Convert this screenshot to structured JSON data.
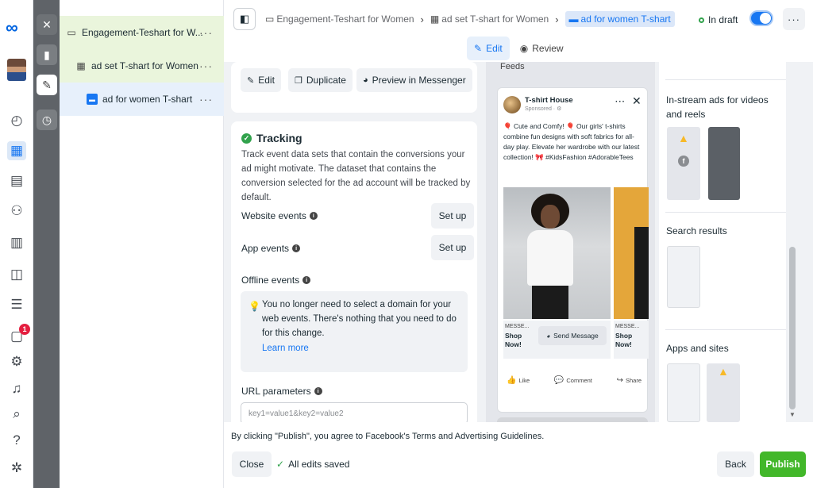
{
  "rail": {
    "logo_icon": "meta-logo-icon",
    "icons": [
      "dashboard-icon",
      "campaigns-grid-icon",
      "pages-icon",
      "audiences-icon",
      "catalog-icon",
      "media-library-icon",
      "menu-icon",
      "notifications-icon",
      "settings-icon",
      "bell-icon",
      "search-icon",
      "help-icon",
      "bug-report-icon"
    ],
    "notification_count": "1"
  },
  "tree": {
    "campaign": "Engagement-Teshart for W...",
    "adset": "ad set T-shart for Women",
    "ad": "ad for women T-shart",
    "more": "···"
  },
  "header": {
    "crumb_campaign": "Engagement-Teshart for Women",
    "crumb_adset": "ad set T-shart for Women",
    "crumb_ad": "ad for women T-shart",
    "status": "In draft",
    "more": "···",
    "tab_edit": "Edit",
    "tab_review": "Review"
  },
  "actions": {
    "edit": "Edit",
    "duplicate": "Duplicate",
    "preview_messenger": "Preview in Messenger"
  },
  "tracking": {
    "title": "Tracking",
    "description": "Track event data sets that contain the conversions your ad might motivate. The dataset that contains the conversion selected for the ad account will be tracked by default.",
    "website_events": "Website events",
    "app_events": "App events",
    "offline_events": "Offline events",
    "setup_label": "Set up",
    "notice": "You no longer need to select a domain for your web events. There's nothing that you need to do for this change.",
    "learn_more": "Learn more",
    "url_parameters": "URL parameters",
    "url_placeholder": "key1=value1&key2=value2"
  },
  "preview": {
    "feed_label": "Feeds",
    "page_name": "T-shirt House",
    "sponsored": "Sponsored · ⚙",
    "post_text": "🎈 Cute and Comfy! 🎈 Our girls' t-shirts combine fun designs with soft fabrics for all-day play. Elevate her wardrobe with our latest collection! 🎀 #KidsFashion #AdorableTees",
    "cta_messenger": "MESSE...",
    "cta_shop": "Shop Now!",
    "send_message": "Send Message",
    "like": "Like",
    "comment": "Comment",
    "share": "Share"
  },
  "placements": {
    "instream": "In-stream ads for videos and reels",
    "search": "Search results",
    "apps": "Apps and sites"
  },
  "footer": {
    "terms_prefix": "By clicking \"Publish\", you agree to Facebook's ",
    "terms_link": "Terms and Advertising Guidelines",
    "terms_suffix": ".",
    "close": "Close",
    "saved": "All edits saved",
    "back": "Back",
    "publish": "Publish"
  },
  "colors": {
    "accent": "#1877f2",
    "publish": "#42b72a",
    "tree_highlight": "#eaf5dc",
    "ad_highlight": "#e7f0fb"
  }
}
